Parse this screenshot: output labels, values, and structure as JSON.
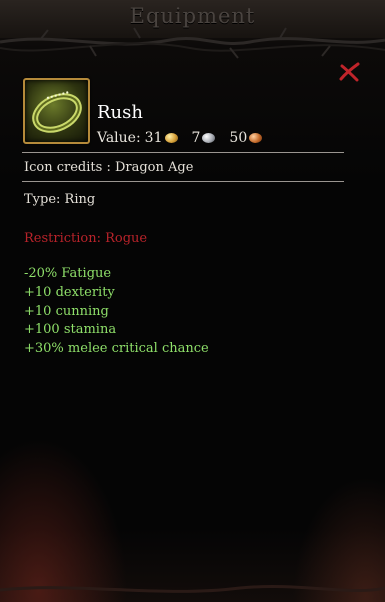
{
  "window": {
    "title": "Equipment"
  },
  "item": {
    "name": "Rush",
    "value_label": "Value:",
    "value": {
      "gold": "31",
      "silver": "7",
      "copper": "50"
    },
    "icon": "ring-icon",
    "credits": "Icon credits : Dragon Age",
    "type": "Type: Ring",
    "restriction": "Restriction: Rogue",
    "effects": [
      "-20% Fatigue",
      "+10 dexterity",
      "+10 cunning",
      "+100 stamina",
      "+30% melee critical chance"
    ]
  },
  "colors": {
    "restriction": "#b8232a",
    "effect": "#8fe06a",
    "close": "#c0242a",
    "icon_border": "#b58a3a"
  }
}
